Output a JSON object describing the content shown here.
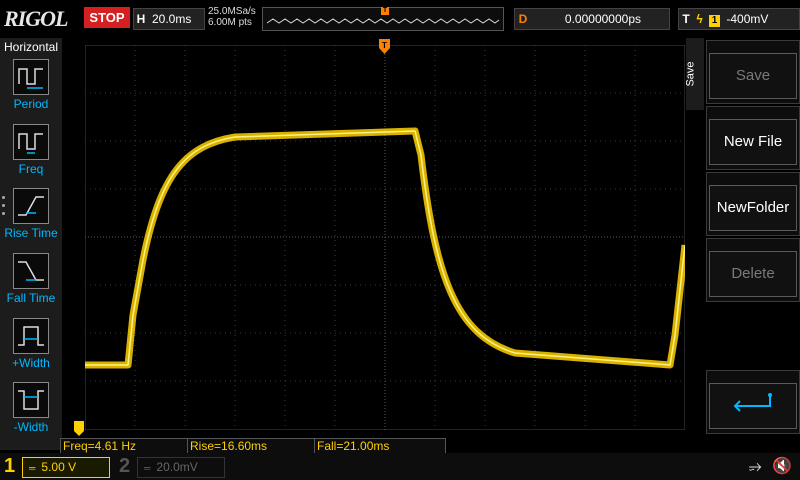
{
  "brand": "RIGOL",
  "run_state": "STOP",
  "timebase": {
    "key": "H",
    "value": "20.0ms"
  },
  "acquisition": {
    "sample_rate": "25.0MSa/s",
    "points": "6.00M pts"
  },
  "overview": {
    "trigger_marker": "T"
  },
  "delay": {
    "key": "D",
    "value": "0.00000000ps"
  },
  "trigger": {
    "key": "T",
    "edge_icon": "rising-edge-icon",
    "source": "1",
    "level": "-400mV"
  },
  "left_panel": {
    "title": "Horizontal",
    "items": [
      {
        "label": "Period",
        "icon": "period-icon"
      },
      {
        "label": "Freq",
        "icon": "freq-icon"
      },
      {
        "label": "Rise Time",
        "icon": "rise-time-icon"
      },
      {
        "label": "Fall Time",
        "icon": "fall-time-icon"
      },
      {
        "label": "+Width",
        "icon": "positive-width-icon"
      },
      {
        "label": "-Width",
        "icon": "negative-width-icon"
      }
    ]
  },
  "right_panel": {
    "tab": "Save",
    "buttons": [
      {
        "label": "Save",
        "enabled": false
      },
      {
        "label": "New File",
        "enabled": true
      },
      {
        "label": "NewFolder",
        "enabled": true
      },
      {
        "label": "Delete",
        "enabled": false
      },
      {
        "label": "",
        "icon": "return-arrow-icon",
        "enabled": true
      }
    ]
  },
  "measurements": [
    {
      "label": "Freq=4.61 Hz"
    },
    {
      "label": "Rise=16.60ms"
    },
    {
      "label": "Fall=21.00ms"
    }
  ],
  "channels": [
    {
      "num": "1",
      "coupling": "═",
      "scale": "5.00 V",
      "active": true,
      "color": "#ffd000"
    },
    {
      "num": "2",
      "coupling": "═",
      "scale": "20.0mV",
      "active": false,
      "color": "#555555"
    }
  ],
  "status_icons": [
    "usb-icon",
    "mute-icon"
  ],
  "colors": {
    "ch1": "#ffd000",
    "trigger": "#ff8000",
    "accent": "#00b8ff",
    "stop": "#d42020"
  }
}
